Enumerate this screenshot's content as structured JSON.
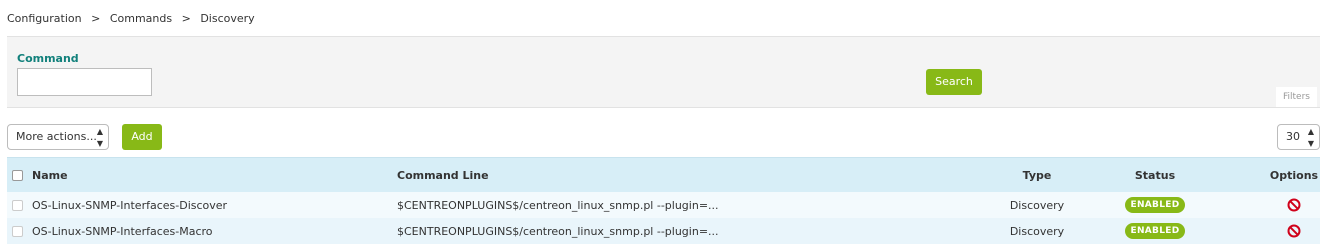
{
  "breadcrumb": {
    "items": [
      "Configuration",
      "Commands",
      "Discovery"
    ],
    "separator": ">"
  },
  "filters": {
    "command_label": "Command",
    "command_value": "",
    "search_label": "Search",
    "filters_tag": "Filters"
  },
  "toolbar": {
    "more_actions_label": "More actions...",
    "add_label": "Add",
    "page_size": "30"
  },
  "table": {
    "columns": {
      "name": "Name",
      "command_line": "Command Line",
      "type": "Type",
      "status": "Status",
      "options": "Options"
    },
    "rows": [
      {
        "name": "OS-Linux-SNMP-Interfaces-Discover",
        "command_line": "$CENTREONPLUGINS$/centreon_linux_snmp.pl --plugin=...",
        "type": "Discovery",
        "status": "ENABLED",
        "options_icon": "disable-icon"
      },
      {
        "name": "OS-Linux-SNMP-Interfaces-Macro",
        "command_line": "$CENTREONPLUGINS$/centreon_linux_snmp.pl --plugin=...",
        "type": "Discovery",
        "status": "ENABLED",
        "options_icon": "disable-icon"
      }
    ]
  },
  "colors": {
    "accent_green": "#88b917",
    "label_teal": "#11807b",
    "header_blue": "#d7eef7",
    "disable_red": "#d0021b"
  }
}
